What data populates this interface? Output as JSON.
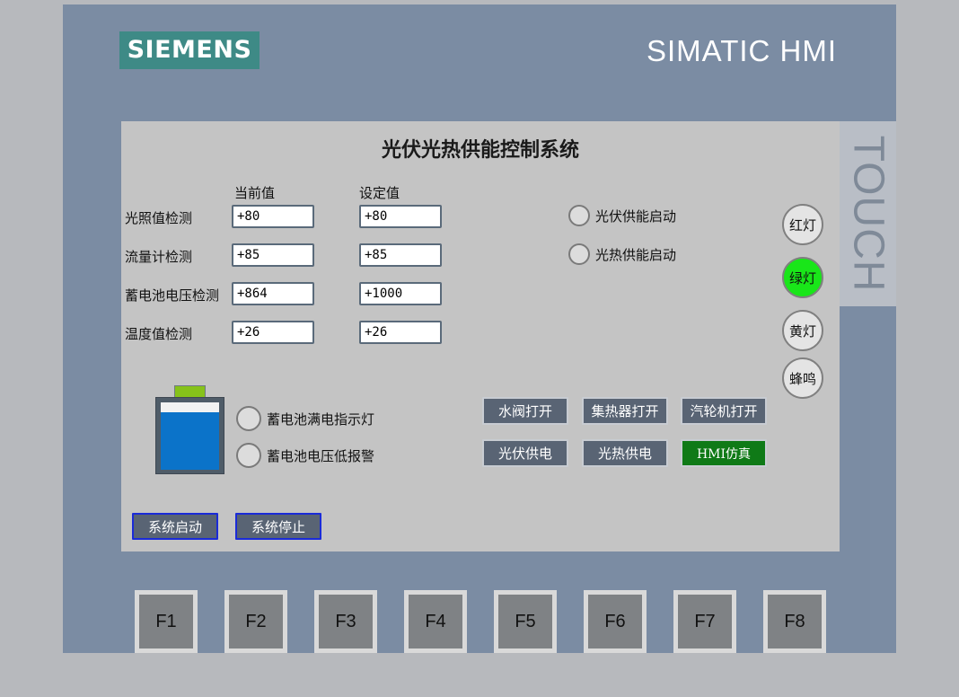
{
  "device": {
    "logo": "SIEMENS",
    "brand": "SIMATIC HMI",
    "touch_label": "TOUCH"
  },
  "screen": {
    "title": "光伏光热供能控制系统",
    "col_current": "当前值",
    "col_setpoint": "设定值",
    "rows": [
      {
        "label": "光照值检测",
        "current": "+80",
        "setpoint": "+80"
      },
      {
        "label": "流量计检测",
        "current": "+85",
        "setpoint": "+85"
      },
      {
        "label": "蓄电池电压检测",
        "current": "+864",
        "setpoint": "+1000"
      },
      {
        "label": "温度值检测",
        "current": "+26",
        "setpoint": "+26"
      }
    ],
    "indicators": {
      "pv_start": "光伏供能启动",
      "pt_start": "光热供能启动",
      "battery_full": "蓄电池满电指示灯",
      "battery_low": "蓄电池电压低报警"
    },
    "lamps": {
      "red": "红灯",
      "green": "绿灯",
      "yellow": "黄灯",
      "buzzer": "蜂鸣",
      "green_color": "#19e619"
    },
    "buttons": {
      "valve_open": "水阀打开",
      "collector_open": "集热器打开",
      "turbine_open": "汽轮机打开",
      "pv_supply": "光伏供电",
      "pt_supply": "光热供电",
      "hmi_sim": "HMI仿真",
      "sys_start": "系统启动",
      "sys_stop": "系统停止"
    },
    "battery_level": 0.86
  },
  "fkeys": [
    "F1",
    "F2",
    "F3",
    "F4",
    "F5",
    "F6",
    "F7",
    "F8"
  ],
  "colors": {
    "bezel": "#7b8ca3",
    "screen": "#c4c4c4",
    "logo_bg": "#3e8a86",
    "button": "#596474",
    "hmi_button": "#0f7a17",
    "battery_fill": "#0b73c9"
  }
}
